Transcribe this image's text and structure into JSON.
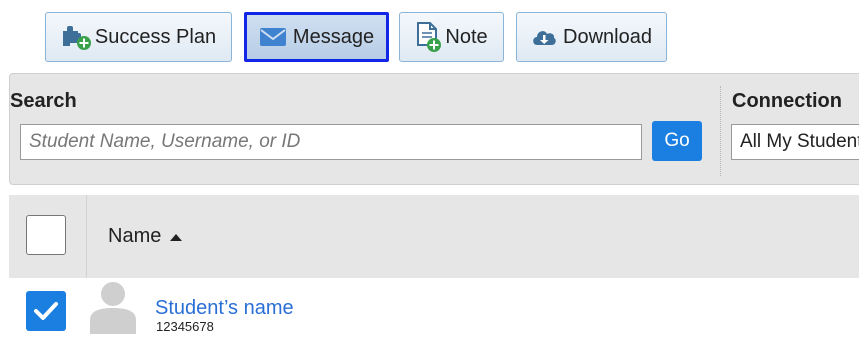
{
  "toolbar": {
    "success_plan_label": "Success Plan",
    "message_label": "Message",
    "note_label": "Note",
    "download_label": "Download"
  },
  "search": {
    "label": "Search",
    "placeholder": "Student Name, Username, or ID",
    "value": "",
    "go_label": "Go"
  },
  "connection": {
    "label": "Connection",
    "selected": "All My Students"
  },
  "table": {
    "name_header": "Name",
    "sort": "ascending"
  },
  "rows": [
    {
      "name": "Student’s name",
      "id": "12345678",
      "checked": true
    }
  ],
  "colors": {
    "accent": "#1a7fe0",
    "selected_border": "#1226e8",
    "link": "#2a6fd6",
    "panel_bg": "#e6e6e6"
  },
  "icons": {
    "success_plan": "puzzle-plus-icon",
    "message": "envelope-icon",
    "note": "note-plus-icon",
    "download": "cloud-download-icon",
    "sort": "caret-up-icon",
    "avatar": "user-silhouette-icon",
    "check": "checkmark-icon"
  }
}
